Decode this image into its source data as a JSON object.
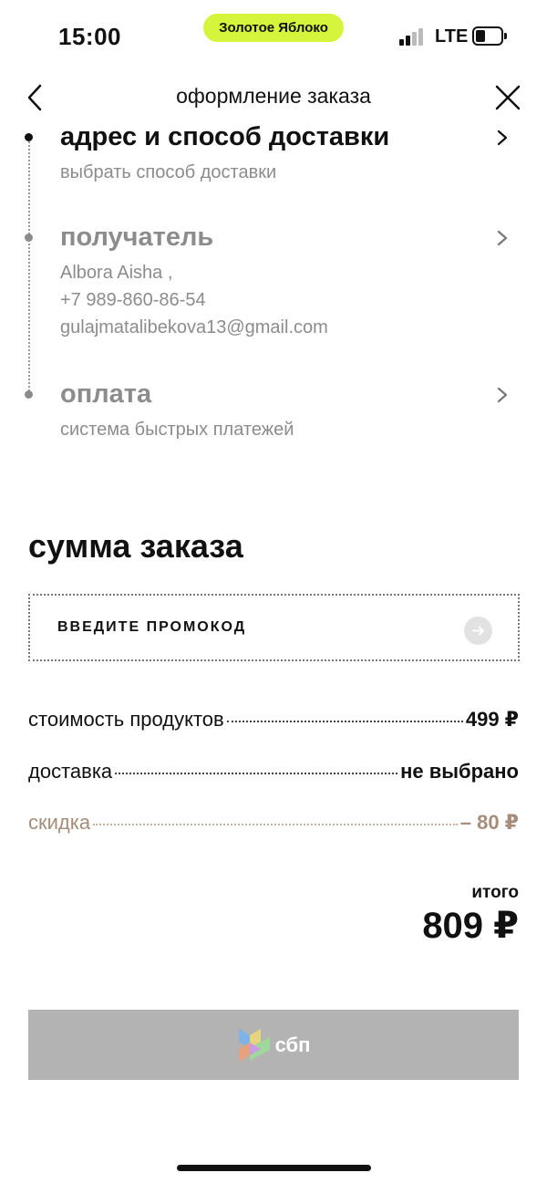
{
  "status_bar": {
    "time": "15:00",
    "app_pill": "Золотое Яблоко",
    "network": "LTE",
    "pill_color": "#d4f53b"
  },
  "header": {
    "title": "оформление заказа",
    "back_icon": "chevron-left-icon",
    "close_icon": "close-icon"
  },
  "steps": [
    {
      "title": "адрес и способ доставки",
      "lines": [
        "выбрать способ доставки"
      ]
    },
    {
      "title": "получатель",
      "lines": [
        "Albora Aisha ,",
        "+7 989-860-86-54",
        "gulajmatalibekova13@gmail.com"
      ]
    },
    {
      "title": "оплата",
      "lines": [
        "система быстрых платежей"
      ]
    }
  ],
  "summary": {
    "title": "сумма заказа",
    "promo_placeholder": "ВВЕДИТЕ ПРОМОКОД",
    "products_label": "стоимость продуктов",
    "products_value": "499 ₽",
    "delivery_label": "доставка",
    "delivery_value": "не выбрано",
    "discount_label": "скидка",
    "discount_value": "– 80 ₽",
    "discount_color": "#a58d7a",
    "total_label": "итого",
    "total_value": "809 ₽"
  },
  "pay_button": {
    "label": "сбп",
    "background": "#b3b3b3",
    "icon": "sbp-logo-icon"
  }
}
